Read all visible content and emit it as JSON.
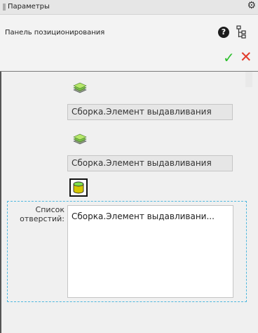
{
  "panel": {
    "title": "Параметры",
    "subtitle": "Панель позиционирования"
  },
  "icons": {
    "gear": "gear-icon",
    "help": "help-icon",
    "tree": "tree-structure-icon",
    "ok": "checkmark-icon",
    "cancel": "close-icon",
    "help_glyph": "?",
    "ok_glyph": "✓",
    "cancel_glyph": "✕",
    "gear_glyph": "⚙"
  },
  "selections": [
    {
      "value": "Сборка.Элемент выдавливания",
      "icon": "feature-stack-icon"
    },
    {
      "value": "Сборка.Элемент выдавливания",
      "icon": "feature-stack-icon"
    }
  ],
  "holes": {
    "label": "Список отверстий:",
    "items": [
      "Сборка.Элемент выдавливани..."
    ],
    "select_icon": "cylinder-select-icon"
  },
  "colors": {
    "ok": "#2ec02e",
    "cancel": "#e23a2a",
    "focus_border": "#4fb8de",
    "feature_green": "#6fcf3a"
  }
}
